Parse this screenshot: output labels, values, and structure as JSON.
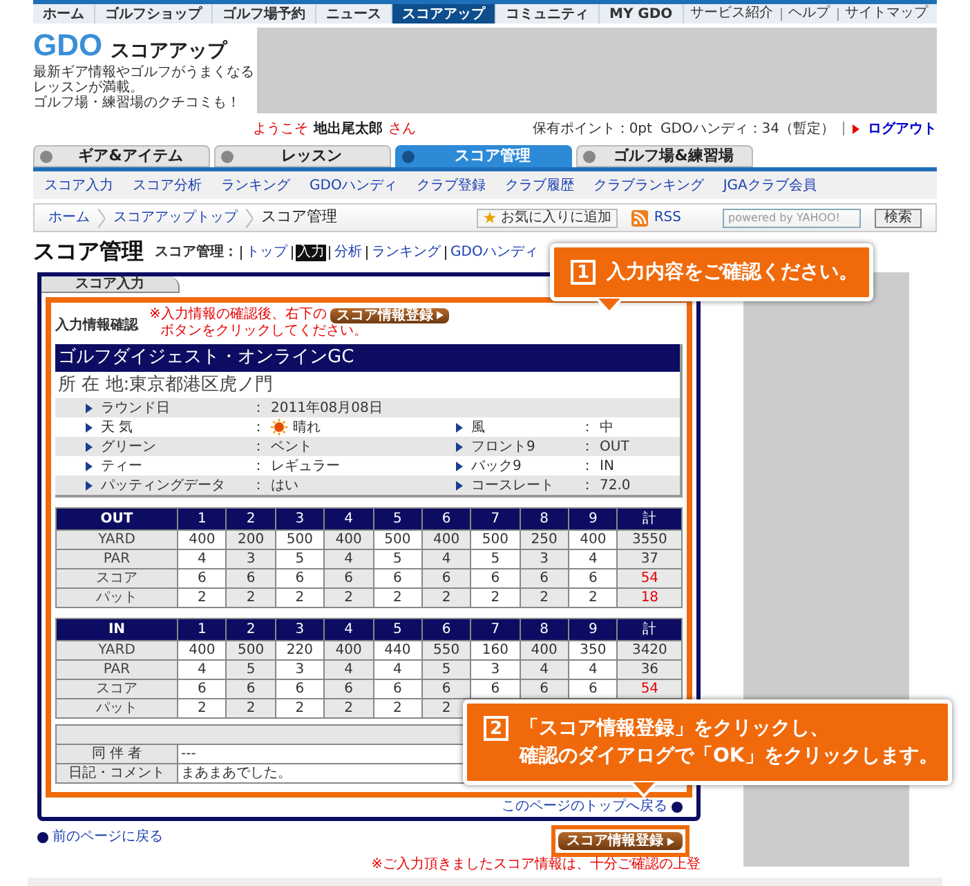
{
  "top_nav": {
    "tabs": [
      {
        "label": "ホーム",
        "selected": false
      },
      {
        "label": "ゴルフショップ",
        "selected": false
      },
      {
        "label": "ゴルフ場予約",
        "selected": false
      },
      {
        "label": "ニュース",
        "selected": false
      },
      {
        "label": "スコアアップ",
        "selected": true
      },
      {
        "label": "コミュニティ",
        "selected": false
      },
      {
        "label": "MY GDO",
        "selected": false
      }
    ],
    "links": [
      "サービス紹介",
      "ヘルプ",
      "サイトマップ"
    ]
  },
  "header": {
    "logo": "GDO",
    "site_name": "スコアアップ",
    "tagline": [
      "最新ギア情報やゴルフがうまくなるレッスンが満載。",
      "ゴルフ場・練習場のクチコミも！"
    ]
  },
  "welcome": {
    "greeting": "ようこそ",
    "user": "地出尾太郎",
    "suffix": "さん"
  },
  "account": {
    "points": "保有ポイント：0pt",
    "handicap": "GDOハンディ：34（暫定）",
    "logout": "ログアウト"
  },
  "category_tabs": [
    {
      "label": "ギア&アイテム",
      "selected": false
    },
    {
      "label": "レッスン",
      "selected": false
    },
    {
      "label": "スコア管理",
      "selected": true
    },
    {
      "label": "ゴルフ場&練習場",
      "selected": false
    }
  ],
  "sub_nav": [
    "スコア入力",
    "スコア分析",
    "ランキング",
    "GDOハンディ",
    "クラブ登録",
    "クラブ履歴",
    "クラブランキング",
    "JGAクラブ会員"
  ],
  "breadcrumb": [
    "ホーム",
    "スコアアップトップ",
    "スコア管理"
  ],
  "tools": {
    "favorite": "お気に入りに追加",
    "rss": "RSS",
    "search_placeholder": "powered by YAHOO!",
    "search_button": "検索"
  },
  "page_title": "スコア管理",
  "page_menu": {
    "label": "スコア管理：",
    "items": [
      {
        "label": "トップ",
        "selected": false
      },
      {
        "label": "入力",
        "selected": true
      },
      {
        "label": "分析",
        "selected": false
      },
      {
        "label": "ランキング",
        "selected": false
      },
      {
        "label": "GDOハンディ",
        "selected": false
      }
    ]
  },
  "panel": {
    "tab": "スコア入力",
    "confirm_label": "入力情報確認",
    "notice_before": "※入力情報の確認後、右下の",
    "notice_button": "スコア情報登録",
    "notice_after": "ボタンをクリックしてください。",
    "course_name": "ゴルフダイジェスト・オンラインGC",
    "address": "所 在 地:東京都港区虎ノ門",
    "info_rows": [
      {
        "left": {
          "label": "ラウンド日",
          "sep": "：",
          "value": "2011年08月08日",
          "kind": "text"
        }
      },
      {
        "left": {
          "label": "天 気",
          "sep": "：",
          "value": "晴れ",
          "kind": "weather"
        },
        "right": {
          "label": "風",
          "sep": "：",
          "value": "中",
          "kind": "text"
        }
      },
      {
        "left": {
          "label": "グリーン",
          "sep": "：",
          "value": "ベント",
          "kind": "text"
        },
        "right": {
          "label": "フロント9",
          "sep": "：",
          "value": "OUT",
          "kind": "text"
        }
      },
      {
        "left": {
          "label": "ティー",
          "sep": "：",
          "value": "レギュラー",
          "kind": "text"
        },
        "right": {
          "label": "バック9",
          "sep": "：",
          "value": "IN",
          "kind": "text"
        }
      },
      {
        "left": {
          "label": "パッティングデータ",
          "sep": "：",
          "value": "はい",
          "kind": "text"
        },
        "right": {
          "label": "コースレート",
          "sep": "：",
          "value": "72.0",
          "kind": "text"
        }
      }
    ],
    "score_tables": [
      {
        "header": [
          "OUT",
          "1",
          "2",
          "3",
          "4",
          "5",
          "6",
          "7",
          "8",
          "9",
          "計"
        ],
        "rows": [
          {
            "label": "YARD",
            "cells": [
              "400",
              "200",
              "500",
              "400",
              "500",
              "400",
              "500",
              "250",
              "400"
            ],
            "total": "3550",
            "total_highlight": false
          },
          {
            "label": "PAR",
            "cells": [
              "4",
              "3",
              "5",
              "4",
              "5",
              "4",
              "5",
              "3",
              "4"
            ],
            "total": "37",
            "total_highlight": false
          },
          {
            "label": "スコア",
            "cells": [
              "6",
              "6",
              "6",
              "6",
              "6",
              "6",
              "6",
              "6",
              "6"
            ],
            "total": "54",
            "total_highlight": true
          },
          {
            "label": "パット",
            "cells": [
              "2",
              "2",
              "2",
              "2",
              "2",
              "2",
              "2",
              "2",
              "2"
            ],
            "total": "18",
            "total_highlight": true
          }
        ]
      },
      {
        "header": [
          "IN",
          "1",
          "2",
          "3",
          "4",
          "5",
          "6",
          "7",
          "8",
          "9",
          "計"
        ],
        "rows": [
          {
            "label": "YARD",
            "cells": [
              "400",
              "500",
              "220",
              "400",
              "440",
              "550",
              "160",
              "400",
              "350"
            ],
            "total": "3420",
            "total_highlight": false
          },
          {
            "label": "PAR",
            "cells": [
              "4",
              "5",
              "3",
              "4",
              "4",
              "5",
              "3",
              "4",
              "4"
            ],
            "total": "36",
            "total_highlight": false
          },
          {
            "label": "スコア",
            "cells": [
              "6",
              "6",
              "6",
              "6",
              "6",
              "6",
              "6",
              "6",
              "6"
            ],
            "total": "54",
            "total_highlight": true
          },
          {
            "label": "パット",
            "cells": [
              "2",
              "2",
              "2",
              "2",
              "2",
              "2"
            ]
          }
        ]
      }
    ],
    "companions_label": "同 伴 者",
    "companions": "---",
    "diary_label": "日記・コメント",
    "diary": "まあまあでした。",
    "page_top": "このページのトップへ戻る"
  },
  "back_link": "前のページに戻る",
  "submit": "スコア情報登録",
  "note": "※ご入力頂きましたスコア情報は、十分ご確認の上登",
  "callouts": [
    {
      "number": "1",
      "lines": [
        "入力内容をご確認ください。"
      ]
    },
    {
      "number": "2",
      "lines": [
        "「スコア情報登録」をクリックし、",
        "確認のダイアログで「OK」をクリックします。"
      ]
    }
  ]
}
